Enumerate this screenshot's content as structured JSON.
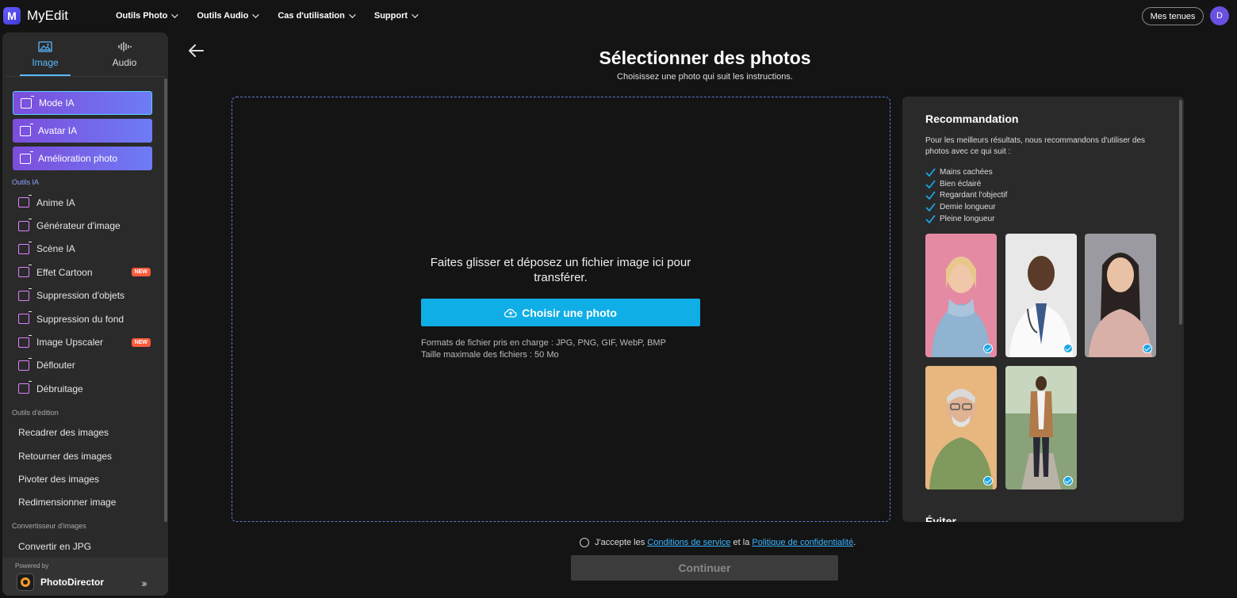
{
  "app": {
    "logo_letter": "M",
    "name": "MyEdit"
  },
  "nav": [
    {
      "label": "Outils Photo"
    },
    {
      "label": "Outils Audio"
    },
    {
      "label": "Cas d'utilisation"
    },
    {
      "label": "Support"
    }
  ],
  "header": {
    "mes_tenues": "Mes tenues",
    "avatar_initial": "D"
  },
  "sidebar": {
    "tabs": [
      {
        "label": "Image",
        "active": true
      },
      {
        "label": "Audio",
        "active": false
      }
    ],
    "featured": [
      {
        "label": "Mode IA"
      },
      {
        "label": "Avatar IA"
      },
      {
        "label": "Amélioration photo"
      }
    ],
    "sections": {
      "ai_tools": "Outils IA",
      "edit_tools": "Outils d'édition",
      "converter": "Convertisseur d'images"
    },
    "ai_items": [
      {
        "label": "Anime IA"
      },
      {
        "label": "Générateur d'image"
      },
      {
        "label": "Scène IA"
      },
      {
        "label": "Effet Cartoon",
        "badge": "NEW"
      },
      {
        "label": "Suppression d'objets"
      },
      {
        "label": "Suppression du fond"
      },
      {
        "label": "Image Upscaler",
        "badge": "NEW"
      },
      {
        "label": "Déflouter"
      },
      {
        "label": "Débruitage"
      }
    ],
    "edit_items": [
      {
        "label": "Recadrer des images"
      },
      {
        "label": "Retourner des images"
      },
      {
        "label": "Pivoter des images"
      },
      {
        "label": "Redimensionner image"
      }
    ],
    "converter_items": [
      {
        "label": "Convertir en JPG"
      }
    ],
    "powered_by": "Powered by",
    "powered_name": "PhotoDirector"
  },
  "main": {
    "title": "Sélectionner des photos",
    "subtitle": "Choisissez une photo qui suit les instructions.",
    "drop_text": "Faites glisser et déposez un fichier image ici pour transférer.",
    "choose_button": "Choisir une photo",
    "formats": "Formats de fichier pris en charge : JPG, PNG, GIF, WebP, BMP",
    "max_size": "Taille maximale des fichiers : 50 Mo"
  },
  "recommendation": {
    "title": "Recommandation",
    "description": "Pour les meilleurs résultats, nous recommandons d'utiliser des photos avec ce qui suit :",
    "checks": [
      "Mains cachées",
      "Bien éclairé",
      "Regardant l'objectif",
      "Demie longueur",
      "Pleine longueur"
    ],
    "avoid_title": "Éviter"
  },
  "footer": {
    "agree_prefix": "J'accepte les",
    "terms_link": "Conditions de service",
    "agree_mid": "et la",
    "privacy_link": "Politique de confidentialité",
    "agree_suffix": ".",
    "continue_label": "Continuer"
  },
  "colors": {
    "accent": "#10aee6",
    "link": "#3ab4ff",
    "badge": "#ff5a3c",
    "pill_start": "#7c4ddb",
    "pill_end": "#6e7cf5"
  }
}
